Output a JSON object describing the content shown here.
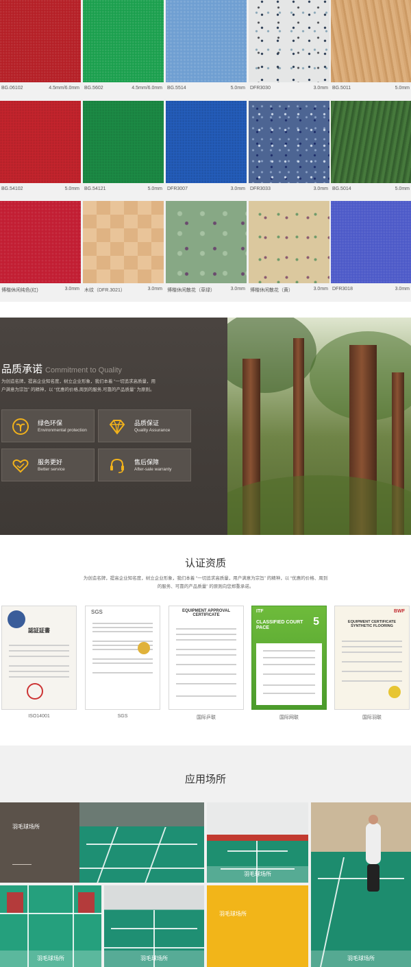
{
  "swatches": [
    {
      "code": "BG.06102",
      "thickness": "4.5mm/6.0mm"
    },
    {
      "code": "BG.5602",
      "thickness": "4.5mm/6.0mm"
    },
    {
      "code": "BG.5514",
      "thickness": "5.0mm"
    },
    {
      "code": "DFR3030",
      "thickness": "3.0mm"
    },
    {
      "code": "BG.5011",
      "thickness": "5.0mm"
    },
    {
      "code": "BG.54102",
      "thickness": "5.0mm"
    },
    {
      "code": "BG.54121",
      "thickness": "5.0mm"
    },
    {
      "code": "DFR3007",
      "thickness": "3.0mm"
    },
    {
      "code": "DFR3033",
      "thickness": "3.0mm"
    },
    {
      "code": "BG.5014",
      "thickness": "5.0mm"
    },
    {
      "code": "博楷休闲纯色(红)",
      "thickness": "3.0mm"
    },
    {
      "code": "木纹（DFR.3021）",
      "thickness": "3.0mm"
    },
    {
      "code": "博楷休闲散花（草绿）",
      "thickness": "3.0mm"
    },
    {
      "code": "博楷休闲散花（黄）",
      "thickness": "3.0mm"
    },
    {
      "code": "DFR3018",
      "thickness": "3.0mm"
    }
  ],
  "quality": {
    "title": "品质承诺",
    "title_en": "Commitment to Quality",
    "description": "为创造名牌，提高企业知名度，树立企业形象，我们本着 “一切追求高质量，用户满意为宗旨” 的精神，以 “优惠的价格,周到的服务,可靠的产品质量” 为原则。",
    "cards": [
      {
        "title": "绿色环保",
        "subtitle": "Environmental protection",
        "icon": "leaf-icon"
      },
      {
        "title": "品质保证",
        "subtitle": "Quality Assurance",
        "icon": "diamond-icon"
      },
      {
        "title": "服务更好",
        "subtitle": "Better service",
        "icon": "heart-icon"
      },
      {
        "title": "售后保障",
        "subtitle": "After-sale warranty",
        "icon": "headset-icon"
      }
    ]
  },
  "certification": {
    "title": "认证资质",
    "description": "为创造名牌，提高企业知名度，树立企业形象，我们本着 “一切追求高质量，用户满意为宗旨” 的精神，以 “优惠的价格、周到的服务、可靠的产品质量” 的原则向您郑重承诺。",
    "items": [
      {
        "label": "ISO14001",
        "heading": "認証証書"
      },
      {
        "label": "SGS",
        "heading": "SGS"
      },
      {
        "label": "国际乒联",
        "heading": "EQUIPMENT APPROVAL CERTIFICATE"
      },
      {
        "label": "国际网联",
        "heading": "CLASSIFIED COURT PACE",
        "badge": "ITF",
        "number": "5"
      },
      {
        "label": "国际羽联",
        "heading": "EQUIPMENT CERTIFICATE SYNTHETIC FLOORING",
        "badge": "BWF"
      }
    ]
  },
  "applications": {
    "title": "应用场所",
    "tiles": [
      {
        "label": "羽毛球场所"
      },
      {
        "label": "羽毛球场所"
      },
      {
        "label": "羽毛球场所"
      },
      {
        "label": "羽毛球场所"
      },
      {
        "label": "羽毛球场所"
      },
      {
        "label": "羽毛球场所"
      }
    ]
  }
}
